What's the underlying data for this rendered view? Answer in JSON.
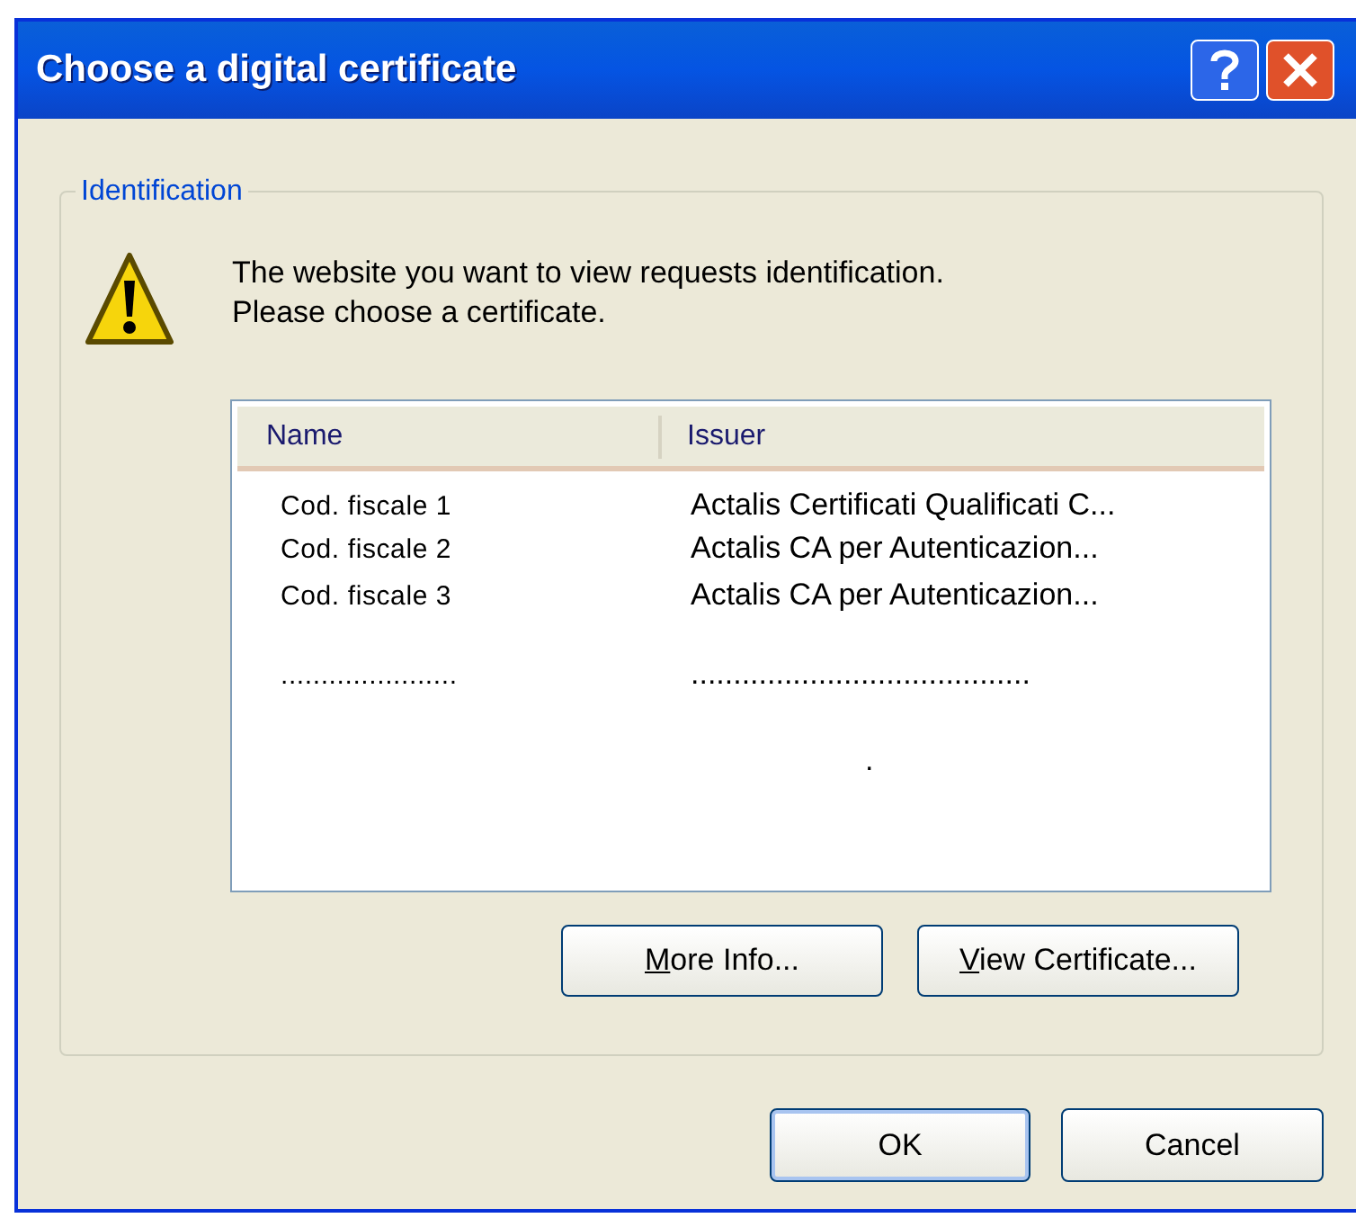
{
  "window": {
    "title": "Choose a digital certificate"
  },
  "group": {
    "label": "Identification",
    "message": [
      "The website you want to view requests identification.",
      "Please choose a certificate."
    ]
  },
  "list": {
    "columns": [
      "Name",
      "Issuer"
    ],
    "rows": [
      {
        "name": "Cod. fiscale 1",
        "issuer": "Actalis Certificati Qualificati C..."
      },
      {
        "name": "Cod. fiscale 2",
        "issuer": "Actalis CA per Autenticazion..."
      },
      {
        "name": "Cod. fiscale 3",
        "issuer": "Actalis CA per Autenticazion..."
      },
      {
        "name": "......................",
        "issuer": "........................................"
      },
      {
        "issuer": "."
      }
    ]
  },
  "group_buttons": [
    {
      "mnemonic": "M",
      "rest": "ore Info..."
    },
    {
      "mnemonic": "V",
      "rest": "iew Certificate..."
    }
  ],
  "buttons": [
    {
      "label": "OK",
      "default": true
    },
    {
      "label": "Cancel",
      "default": false
    }
  ]
}
